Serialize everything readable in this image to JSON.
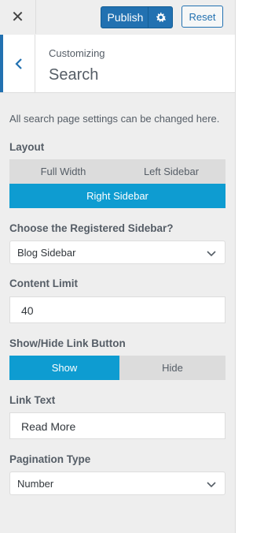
{
  "topbar": {
    "close_glyph": "✕",
    "publish_label": "Publish",
    "settings_icon": "gear-icon",
    "reset_label": "Reset"
  },
  "section": {
    "customizing_label": "Customizing",
    "title": "Search",
    "back_icon": "chevron-left-icon"
  },
  "description": "All search page settings can be changed here.",
  "layout": {
    "label": "Layout",
    "options": [
      "Full Width",
      "Left Sidebar",
      "Right Sidebar"
    ],
    "selected": "Right Sidebar"
  },
  "registered_sidebar": {
    "label": "Choose the Registered Sidebar?",
    "value": "Blog Sidebar"
  },
  "content_limit": {
    "label": "Content Limit",
    "value": "40"
  },
  "link_button": {
    "label": "Show/Hide Link Button",
    "options": [
      "Show",
      "Hide"
    ],
    "selected": "Show"
  },
  "link_text": {
    "label": "Link Text",
    "value": "Read More"
  },
  "pagination": {
    "label": "Pagination Type",
    "value": "Number"
  },
  "colors": {
    "accent_blue": "#2271b1",
    "segment_active": "#0e9cd1",
    "panel_bg": "#eeeeee"
  }
}
